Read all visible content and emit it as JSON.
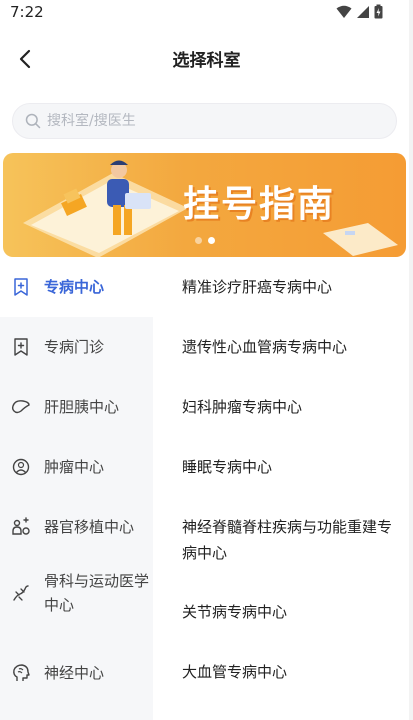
{
  "status": {
    "time": "7:22"
  },
  "header": {
    "title": "选择科室"
  },
  "search": {
    "placeholder": "搜科室/搜医生"
  },
  "banner": {
    "title": "挂号指南",
    "slides": 2,
    "active_slide": 1
  },
  "sidebar": {
    "items": [
      {
        "label": "专病中心",
        "icon": "bookmark-plus-icon",
        "active": true
      },
      {
        "label": "专病门诊",
        "icon": "bookmark-plus-icon",
        "active": false
      },
      {
        "label": "肝胆胰中心",
        "icon": "liver-icon",
        "active": false
      },
      {
        "label": "肿瘤中心",
        "icon": "tumor-icon",
        "active": false
      },
      {
        "label": "器官移植中心",
        "icon": "organ-transplant-icon",
        "active": false
      },
      {
        "label": "骨科与运动医学中心",
        "icon": "bone-icon",
        "active": false
      },
      {
        "label": "神经中心",
        "icon": "brain-head-icon",
        "active": false
      }
    ]
  },
  "departments": {
    "items": [
      {
        "label": "精准诊疗肝癌专病中心"
      },
      {
        "label": "遗传性心血管病专病中心"
      },
      {
        "label": "妇科肿瘤专病中心"
      },
      {
        "label": "睡眠专病中心"
      },
      {
        "label": "神经脊髓脊柱疾病与功能重建专病中心"
      },
      {
        "label": "关节病专病中心"
      },
      {
        "label": "大血管专病中心"
      }
    ]
  },
  "colors": {
    "accent": "#3a66d8",
    "banner": "#f5a33b",
    "sidebar_bg": "#f6f7f9"
  }
}
